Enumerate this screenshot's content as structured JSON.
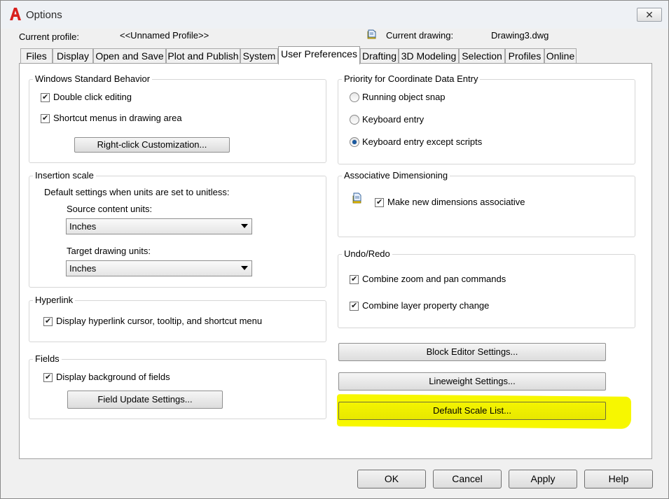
{
  "window": {
    "title": "Options",
    "close_label": "✕"
  },
  "header": {
    "current_profile_label": "Current profile:",
    "current_profile_value": "<<Unnamed Profile>>",
    "current_drawing_label": "Current drawing:",
    "current_drawing_value": "Drawing3.dwg"
  },
  "tabs": [
    {
      "label": "Files",
      "active": false
    },
    {
      "label": "Display",
      "active": false
    },
    {
      "label": "Open and Save",
      "active": false
    },
    {
      "label": "Plot and Publish",
      "active": false
    },
    {
      "label": "System",
      "active": false
    },
    {
      "label": "User Preferences",
      "active": true
    },
    {
      "label": "Drafting",
      "active": false
    },
    {
      "label": "3D Modeling",
      "active": false
    },
    {
      "label": "Selection",
      "active": false
    },
    {
      "label": "Profiles",
      "active": false
    },
    {
      "label": "Online",
      "active": false
    }
  ],
  "windows_behavior": {
    "title": "Windows Standard Behavior",
    "double_click": {
      "label": "Double click editing",
      "checked": true
    },
    "shortcut_menus": {
      "label": "Shortcut menus in drawing area",
      "checked": true
    },
    "right_click_button": "Right-click Customization..."
  },
  "insertion_scale": {
    "title": "Insertion scale",
    "description": "Default settings when units are set to unitless:",
    "source_label": "Source content units:",
    "source_value": "Inches",
    "target_label": "Target drawing units:",
    "target_value": "Inches"
  },
  "hyperlink": {
    "title": "Hyperlink",
    "display": {
      "label": "Display hyperlink cursor, tooltip, and shortcut menu",
      "checked": true
    }
  },
  "fields": {
    "title": "Fields",
    "display_bg": {
      "label": "Display background of fields",
      "checked": true
    },
    "update_button": "Field Update Settings..."
  },
  "coordinate_priority": {
    "title": "Priority for Coordinate Data Entry",
    "options": [
      {
        "label": "Running object snap",
        "selected": false
      },
      {
        "label": "Keyboard entry",
        "selected": false
      },
      {
        "label": "Keyboard entry except scripts",
        "selected": true
      }
    ]
  },
  "assoc_dim": {
    "title": "Associative Dimensioning",
    "make_assoc": {
      "label": "Make new dimensions associative",
      "checked": true
    }
  },
  "undo_redo": {
    "title": "Undo/Redo",
    "combine_zoom": {
      "label": "Combine zoom and pan commands",
      "checked": true
    },
    "combine_layer": {
      "label": "Combine layer property change",
      "checked": true
    }
  },
  "side_buttons": {
    "block_editor": "Block Editor Settings...",
    "lineweight": "Lineweight Settings...",
    "default_scale": "Default Scale List..."
  },
  "footer": {
    "ok": "OK",
    "cancel": "Cancel",
    "apply": "Apply",
    "help": "Help"
  },
  "colors": {
    "highlight": "#f7f700",
    "app_icon": "#d8201e",
    "radio_selected": "#1a5aa0"
  },
  "icons": {
    "app": "autocad-a-icon",
    "drawing": "drawing-file-icon",
    "assoc_dim": "associative-dimension-icon"
  }
}
